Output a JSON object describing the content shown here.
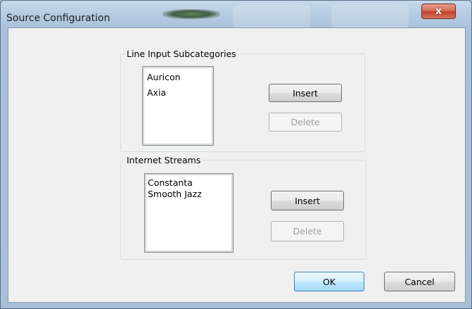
{
  "window": {
    "title": "Source Configuration",
    "close_glyph": "x"
  },
  "line_input": {
    "legend": "Line Input Subcategories",
    "items": [
      "Auricon",
      "Axia"
    ],
    "insert_label": "Insert",
    "delete_label": "Delete"
  },
  "internet_streams": {
    "legend": "Internet Streams",
    "items": [
      "Constanta",
      "Smooth Jazz"
    ],
    "insert_label": "Insert",
    "delete_label": "Delete"
  },
  "footer": {
    "ok_label": "OK",
    "cancel_label": "Cancel"
  },
  "colors": {
    "close_button": "#c7432a",
    "default_button_border": "#3c7fb1",
    "dialog_background": "#f0f0f0"
  }
}
